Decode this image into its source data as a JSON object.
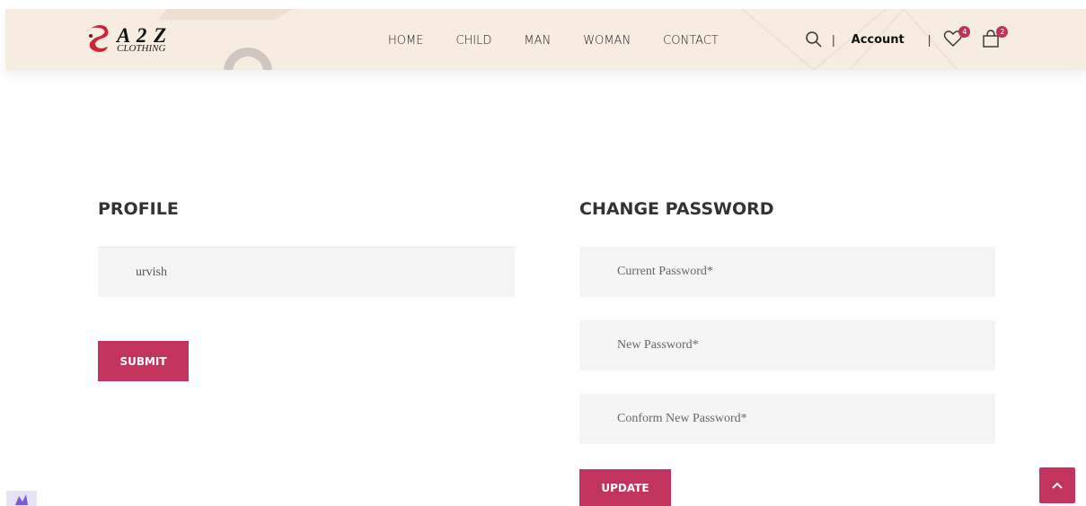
{
  "brand": {
    "name": "A 2 Z",
    "tagline": "CLOTHING"
  },
  "nav": {
    "items": [
      "HOME",
      "CHILD",
      "MAN",
      "WOMAN",
      "CONTACT"
    ]
  },
  "header_actions": {
    "search_icon": "search-icon",
    "separator": "|",
    "account_label": "Account",
    "wishlist_count": "4",
    "cart_count": "2"
  },
  "profile": {
    "title": "PROFILE",
    "username_value": "urvish",
    "submit_label": "SUBMIT"
  },
  "change_password": {
    "title": "CHANGE PASSWORD",
    "current_placeholder": "Current Password*",
    "new_placeholder": "New Password*",
    "confirm_placeholder": "Conform New Password*",
    "update_label": "UPDATE"
  },
  "colors": {
    "accent": "#c2335e",
    "header_bg": "#f6ece0",
    "field_bg": "#f5f5f5"
  }
}
